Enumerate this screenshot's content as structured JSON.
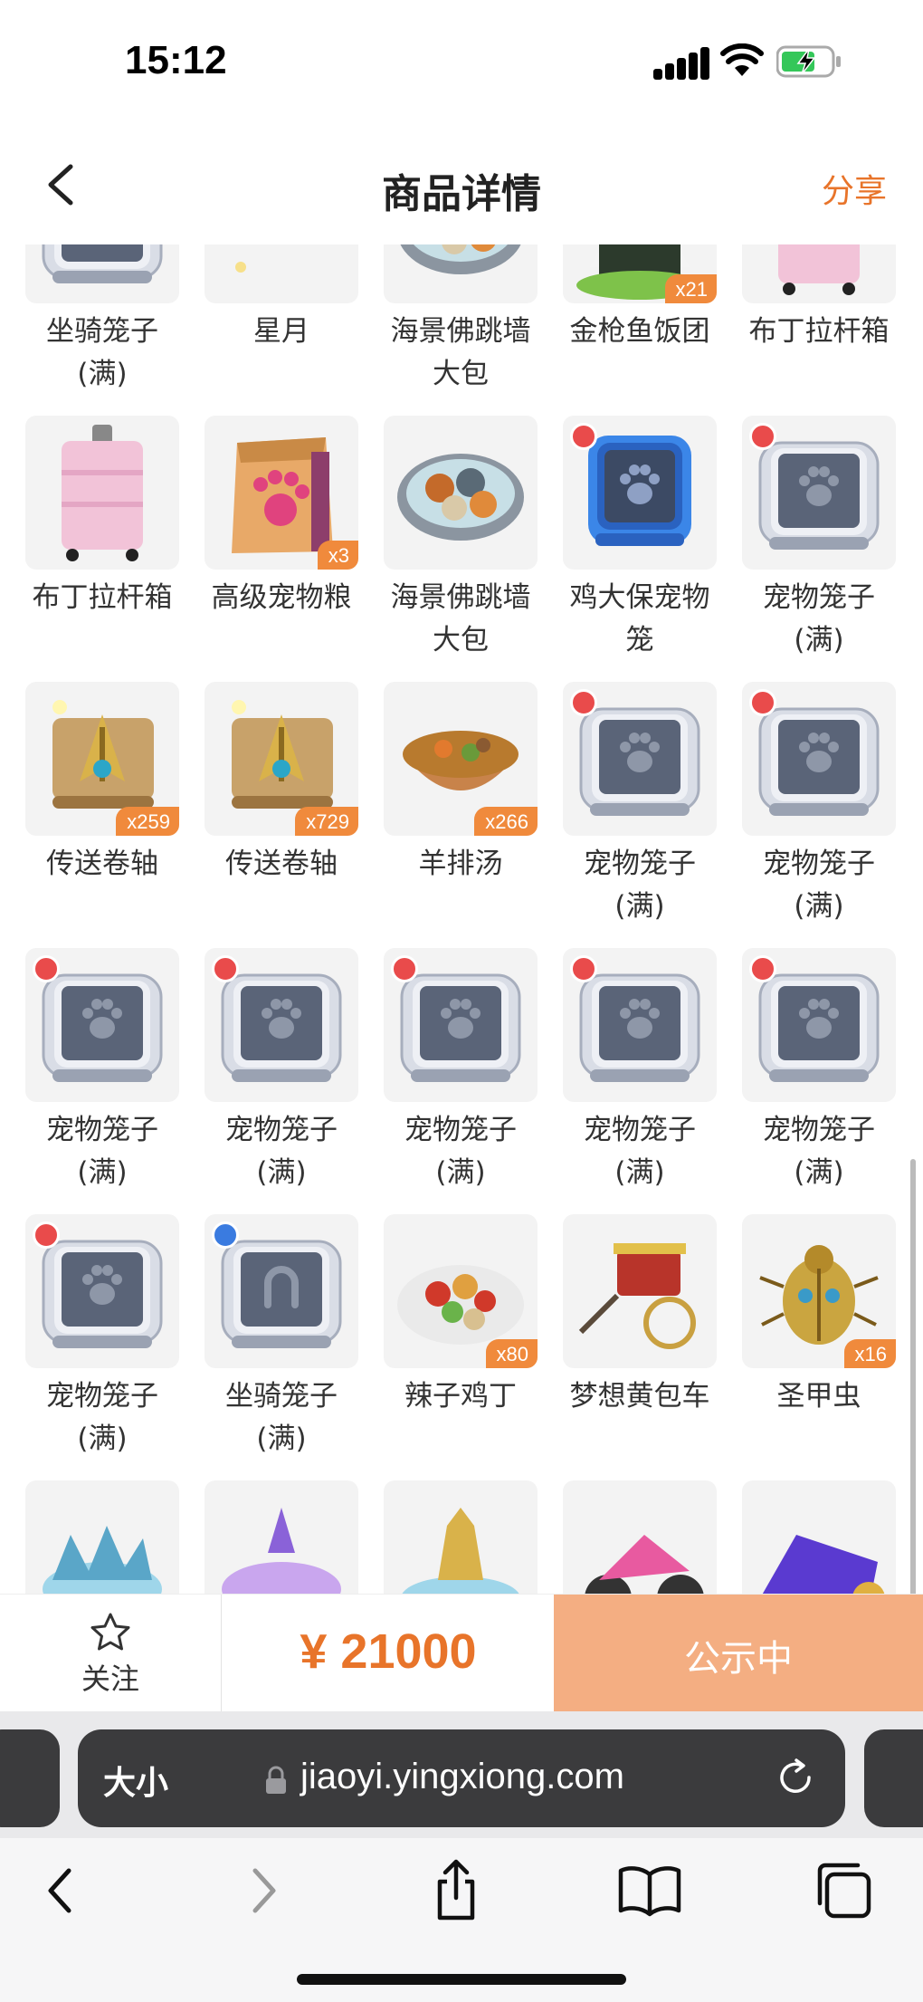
{
  "status_bar": {
    "time": "15:12"
  },
  "header": {
    "title": "商品详情",
    "share_label": "分享"
  },
  "grid": {
    "rows": [
      [
        {
          "name": "坐骑笼子\n(满)",
          "icon": "mount-cage-icon",
          "qty": "",
          "badge": ""
        },
        {
          "name": "星月",
          "icon": "star-moon-icon",
          "qty": "",
          "badge": ""
        },
        {
          "name": "海景佛跳墙\n大包",
          "icon": "seafood-soup-icon",
          "qty": "",
          "badge": ""
        },
        {
          "name": "金枪鱼饭团",
          "icon": "tuna-rice-ball-icon",
          "qty": "x21",
          "badge": ""
        },
        {
          "name": "布丁拉杆箱",
          "icon": "pink-suitcase-icon",
          "qty": "",
          "badge": ""
        }
      ],
      [
        {
          "name": "布丁拉杆箱",
          "icon": "pink-suitcase-icon",
          "qty": "",
          "badge": ""
        },
        {
          "name": "高级宠物粮",
          "icon": "pet-food-bag-icon",
          "qty": "x3",
          "badge": ""
        },
        {
          "name": "海景佛跳墙\n大包",
          "icon": "seafood-soup-icon",
          "qty": "",
          "badge": ""
        },
        {
          "name": "鸡大保宠物\n笼",
          "icon": "blue-pet-cage-icon",
          "qty": "",
          "badge": "red"
        },
        {
          "name": "宠物笼子\n(满)",
          "icon": "pet-cage-icon",
          "qty": "",
          "badge": "red"
        }
      ],
      [
        {
          "name": "传送卷轴",
          "icon": "teleport-scroll-icon",
          "qty": "x259",
          "badge": ""
        },
        {
          "name": "传送卷轴",
          "icon": "teleport-scroll-icon",
          "qty": "x729",
          "badge": ""
        },
        {
          "name": "羊排汤",
          "icon": "lamb-soup-icon",
          "qty": "x266",
          "badge": ""
        },
        {
          "name": "宠物笼子\n(满)",
          "icon": "pet-cage-icon",
          "qty": "",
          "badge": "red"
        },
        {
          "name": "宠物笼子\n(满)",
          "icon": "pet-cage-icon",
          "qty": "",
          "badge": "red"
        }
      ],
      [
        {
          "name": "宠物笼子\n(满)",
          "icon": "pet-cage-icon",
          "qty": "",
          "badge": "red"
        },
        {
          "name": "宠物笼子\n(满)",
          "icon": "pet-cage-icon",
          "qty": "",
          "badge": "red"
        },
        {
          "name": "宠物笼子\n(满)",
          "icon": "pet-cage-icon",
          "qty": "",
          "badge": "red"
        },
        {
          "name": "宠物笼子\n(满)",
          "icon": "pet-cage-icon",
          "qty": "",
          "badge": "red"
        },
        {
          "name": "宠物笼子\n(满)",
          "icon": "pet-cage-icon",
          "qty": "",
          "badge": "red"
        }
      ],
      [
        {
          "name": "宠物笼子\n(满)",
          "icon": "pet-cage-icon",
          "qty": "",
          "badge": "red"
        },
        {
          "name": "坐骑笼子\n(满)",
          "icon": "mount-cage-icon",
          "qty": "",
          "badge": "blue"
        },
        {
          "name": "辣子鸡丁",
          "icon": "spicy-chicken-icon",
          "qty": "x80",
          "badge": ""
        },
        {
          "name": "梦想黄包车",
          "icon": "rickshaw-icon",
          "qty": "",
          "badge": ""
        },
        {
          "name": "圣甲虫",
          "icon": "scarab-icon",
          "qty": "x16",
          "badge": ""
        }
      ],
      [
        {
          "name": "",
          "icon": "ice-platform-icon",
          "qty": "",
          "badge": ""
        },
        {
          "name": "",
          "icon": "crystal-platform-icon",
          "qty": "",
          "badge": ""
        },
        {
          "name": "",
          "icon": "golden-platform-icon",
          "qty": "",
          "badge": ""
        },
        {
          "name": "",
          "icon": "pink-motorcycle-icon",
          "qty": "",
          "badge": ""
        },
        {
          "name": "",
          "icon": "purple-motorcycle-icon",
          "qty": "",
          "badge": ""
        }
      ]
    ]
  },
  "action_bar": {
    "follow_label": "关注",
    "price": "¥ 21000",
    "status_label": "公示中"
  },
  "browser": {
    "size_label": "大小",
    "url": "jiaoyi.yingxiong.com"
  },
  "colors": {
    "accent": "#e8742a",
    "status_button": "#f4ae82",
    "qty_tag": "#f08a3c"
  }
}
